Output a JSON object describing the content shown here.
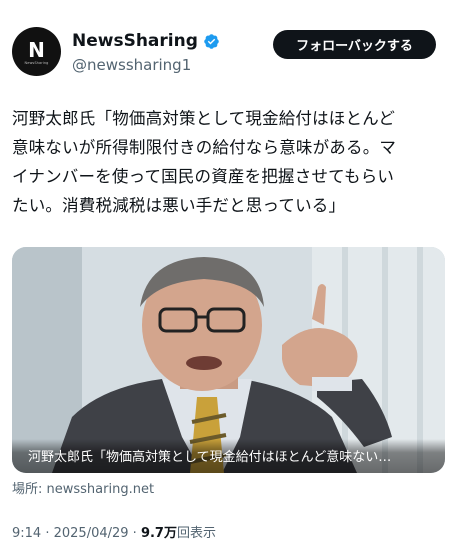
{
  "account": {
    "avatar_letter": "N",
    "avatar_sub": "NewsSharing",
    "display_name": "NewsSharing",
    "handle": "@newssharing1",
    "verified": true
  },
  "follow_button": {
    "label": "フォローバックする"
  },
  "tweet": {
    "lines": [
      "河野太郎氏「物価高対策として現金給付はほとんど",
      "意味ないが所得制限付きの給付なら意味がある。マ",
      "イナンバーを使って国民の資産を把握させてもらい",
      "たい。消費税減税は悪い手だと思っている」"
    ]
  },
  "media": {
    "caption": "河野太郎氏「物価高対策として現金給付はほとんど意味ない…",
    "source": "場所: newssharing.net"
  },
  "meta": {
    "time": "9:14",
    "separator": " · ",
    "date": "2025/04/29",
    "views_count": "9.7万",
    "views_label": "回表示"
  },
  "colors": {
    "primary_text": "#0f1419",
    "secondary_text": "#536471",
    "verified_blue": "#1d9bf0",
    "button_bg": "#0f1419"
  }
}
